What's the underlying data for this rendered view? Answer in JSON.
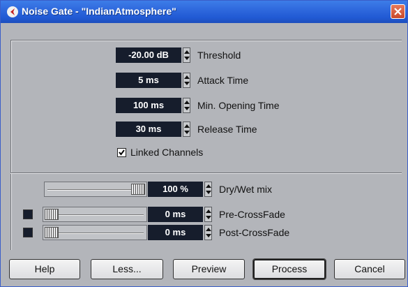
{
  "window": {
    "title": "Noise Gate - \"IndianAtmosphere\""
  },
  "params": {
    "threshold": {
      "value": "-20.00 dB",
      "label": "Threshold"
    },
    "attack": {
      "value": "5 ms",
      "label": "Attack Time"
    },
    "min_opening": {
      "value": "100 ms",
      "label": "Min. Opening Time"
    },
    "release": {
      "value": "30 ms",
      "label": "Release Time"
    }
  },
  "linked_channels": {
    "label": "Linked Channels",
    "checked": true
  },
  "mix": {
    "drywet": {
      "value": "100 %",
      "label": "Dry/Wet mix",
      "level": 1.0
    },
    "pre_crossfade": {
      "value": "0 ms",
      "label": "Pre-CrossFade",
      "level": 0.0
    },
    "post_crossfade": {
      "value": "0 ms",
      "label": "Post-CrossFade",
      "level": 0.0
    }
  },
  "buttons": {
    "help": "Help",
    "less": "Less...",
    "preview": "Preview",
    "process": "Process",
    "cancel": "Cancel"
  },
  "colors": {
    "titlebar": "#2f69dd",
    "value_box": "#161d2c",
    "body": "#b3b5ba"
  }
}
